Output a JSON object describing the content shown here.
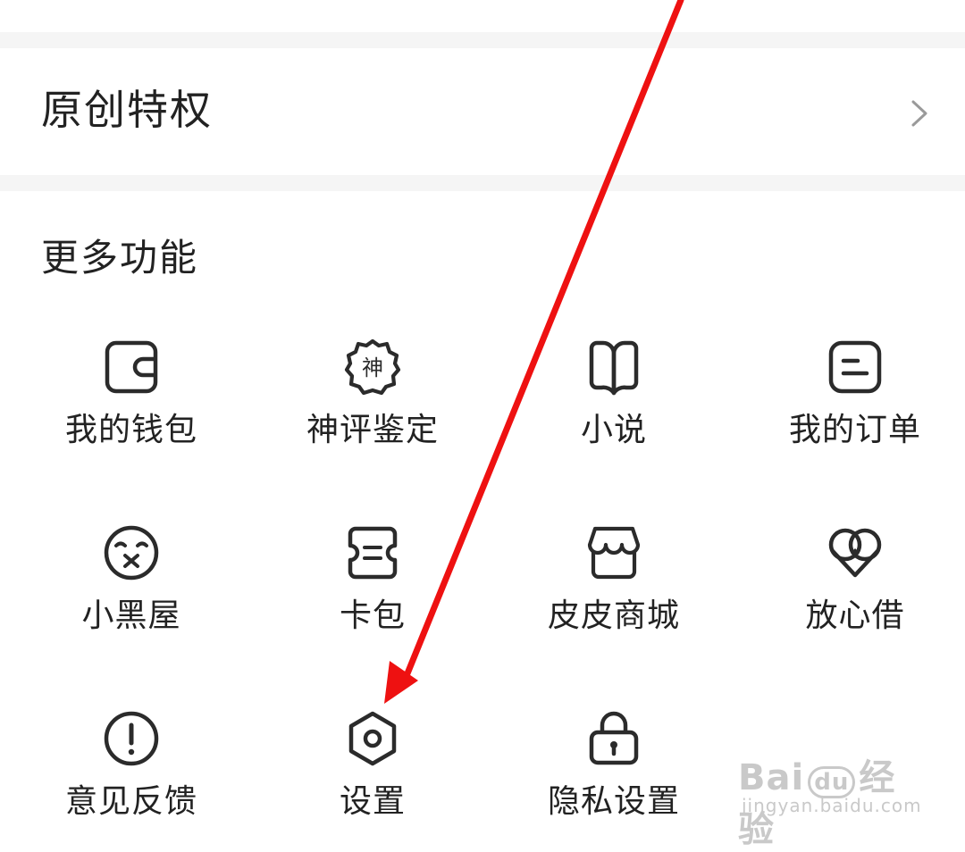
{
  "privilege": {
    "title": "原创特权"
  },
  "more": {
    "title": "更多功能",
    "items": [
      {
        "label": "我的钱包",
        "icon": "wallet-icon"
      },
      {
        "label": "神评鉴定",
        "icon": "badge-icon"
      },
      {
        "label": "小说",
        "icon": "book-icon"
      },
      {
        "label": "我的订单",
        "icon": "order-icon"
      },
      {
        "label": "小黑屋",
        "icon": "sad-face-icon"
      },
      {
        "label": "卡包",
        "icon": "ticket-icon"
      },
      {
        "label": "皮皮商城",
        "icon": "store-icon"
      },
      {
        "label": "放心借",
        "icon": "heart-coin-icon"
      },
      {
        "label": "意见反馈",
        "icon": "exclamation-icon"
      },
      {
        "label": "设置",
        "icon": "gear-icon"
      },
      {
        "label": "隐私设置",
        "icon": "lock-icon"
      }
    ]
  },
  "watermark": {
    "brand": "Bai",
    "brand_du": "du",
    "brand_cn": "经验",
    "url": "jingyan.baidu.com"
  },
  "colors": {
    "icon_stroke": "#2b2b2b",
    "arrow": "#ee1111",
    "separator": "#f5f5f5"
  }
}
